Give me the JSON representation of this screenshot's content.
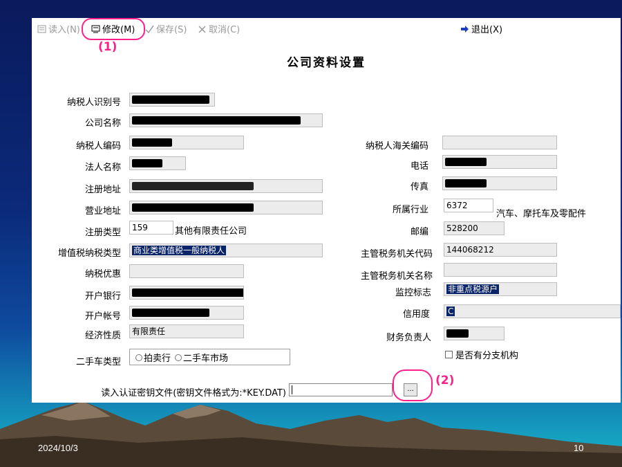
{
  "toolbar": {
    "read": "读入(N)",
    "modify": "修改(M)",
    "save": "保存(S)",
    "cancel": "取消(C)",
    "exit": "退出(X)"
  },
  "annotations": {
    "step1": "(1)",
    "step2": "(2)"
  },
  "form": {
    "title": "公司资料设置",
    "taxpayer_id_label": "纳税人识别号",
    "company_name_label": "公司名称",
    "taxpayer_code_label": "纳税人编码",
    "legal_rep_label": "法人名称",
    "reg_address_label": "注册地址",
    "biz_address_label": "营业地址",
    "reg_type_label": "注册类型",
    "reg_type_code": "159",
    "reg_type_text": "其他有限责任公司",
    "vat_type_label": "增值税纳税类型",
    "vat_type_value": "商业类增值税一般纳税人",
    "tax_pref_label": "纳税优惠",
    "bank_label": "开户银行",
    "account_label": "开户帐号",
    "econ_label": "经济性质",
    "econ_value": "有限责任",
    "used_car_label": "二手车类型",
    "used_car_opt1": "拍卖行",
    "used_car_opt2": "二手车市场",
    "customs_code_label": "纳税人海关编码",
    "phone_label": "电话",
    "fax_label": "传真",
    "industry_label": "所属行业",
    "industry_code": "6372",
    "industry_text": "汽车、摩托车及零配件",
    "postcode_label": "邮编",
    "postcode_value": "528200",
    "tax_office_code_label": "主管税务机关代码",
    "tax_office_code_value": "144068212",
    "tax_office_name_label": "主管税务机关名称",
    "monitor_label": "监控标志",
    "monitor_value": "非重点税源户",
    "credit_label": "信用度",
    "credit_value": "C",
    "finance_label": "财务负责人",
    "branch_label": "是否有分支机构",
    "key_file_label": "读入认证密钥文件(密钥文件格式为:*KEY.DAT)",
    "browse_label": "..."
  },
  "footer": {
    "date": "2024/10/3",
    "page": "10"
  },
  "colors": {
    "highlight": "#ff1f8a",
    "selection": "#0a246a"
  }
}
